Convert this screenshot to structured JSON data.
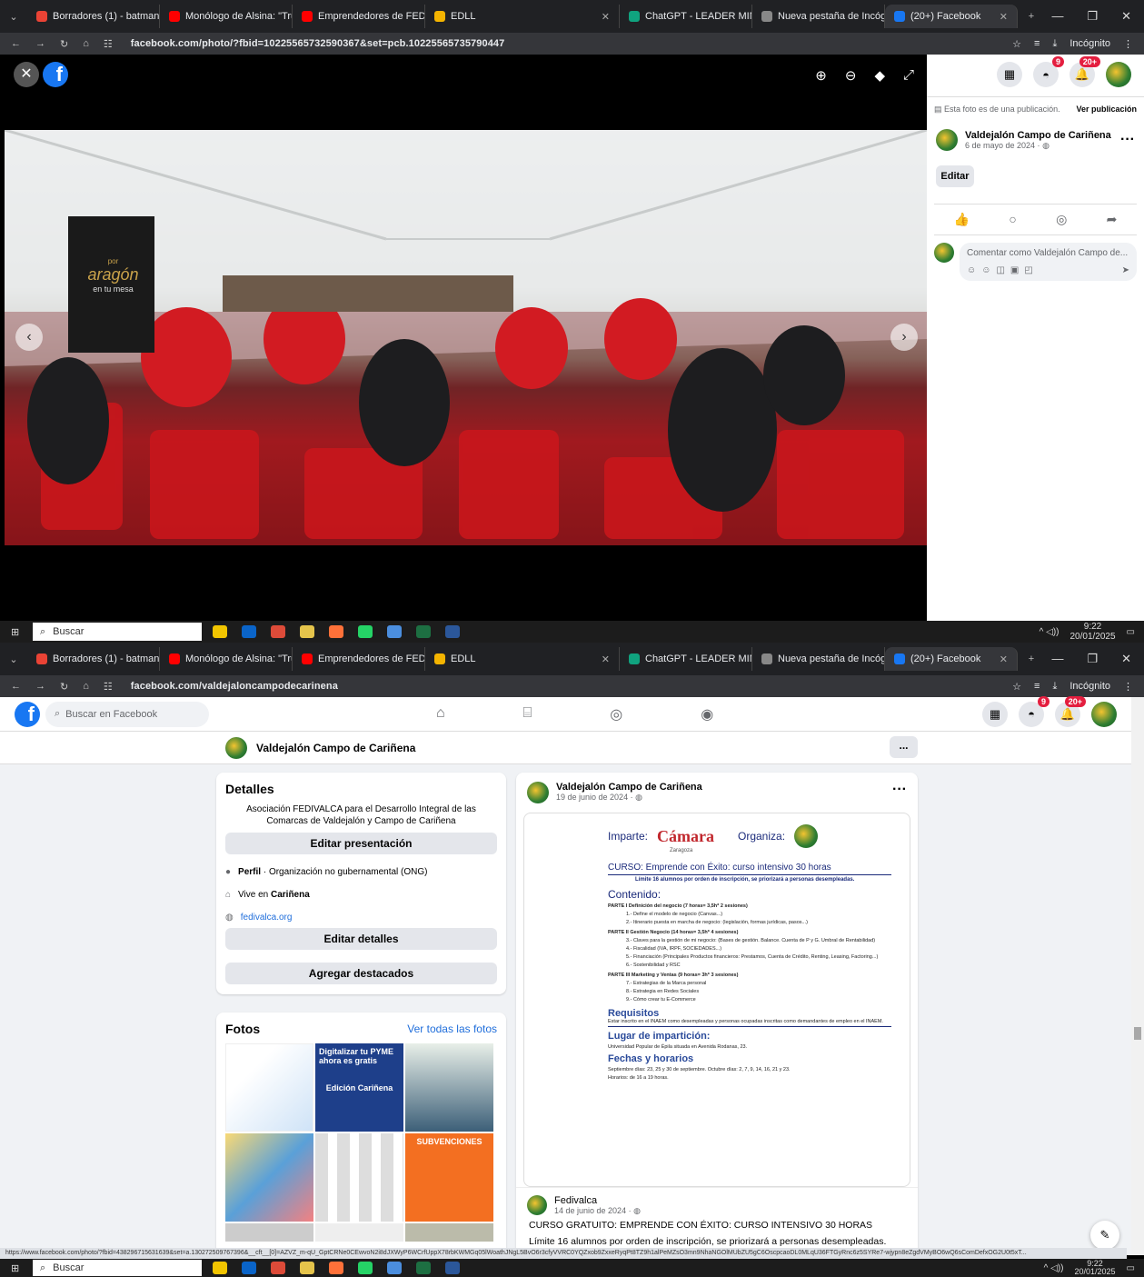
{
  "browser": {
    "tabs": [
      {
        "label": "Borradores (1) - batmanorteroll",
        "color": "#ea4335"
      },
      {
        "label": "Monólogo de Alsina: \"Trum",
        "color": "#ff0000"
      },
      {
        "label": "Emprendedores de FEDIVALCA",
        "color": "#ff0000"
      },
      {
        "label": "EDLL",
        "color": "#f4b400"
      },
      {
        "label": "ChatGPT - LEADER MIND",
        "color": "#10a37f"
      },
      {
        "label": "Nueva pestaña de Incógnito",
        "color": "#888888"
      },
      {
        "label": "(20+) Facebook",
        "color": "#1877f2"
      }
    ],
    "url_top": "facebook.com/photo/?fbid=10225565732590367&set=pcb.10225565735790447",
    "url_bottom": "facebook.com/valdejaloncampodecarinena",
    "incognito": "Incógnito"
  },
  "photo_viewer": {
    "banner_brand": "aragón",
    "banner_small": "por",
    "banner_sub": "en tu mesa",
    "notice": "Esta foto es de una publicación.",
    "see_post": "Ver publicación",
    "author": "Valdejalón Campo de Cariñena",
    "date": "6 de mayo de 2024 · ",
    "edit": "Editar",
    "comment_placeholder": "Comentar como Valdejalón Campo de..."
  },
  "notifications": {
    "messenger": "9",
    "bell": "20+"
  },
  "taskbar": {
    "search": "Buscar",
    "time": "9:22",
    "date": "20/01/2025"
  },
  "profile": {
    "search_placeholder": "Buscar en Facebook",
    "page_name": "Valdejalón Campo de Cariñena",
    "more": "...",
    "details_title": "Detalles",
    "description": "Asociación FEDIVALCA para el Desarrollo Integral de las Comarcas de Valdejalón y Campo de Cariñena",
    "edit_presentation": "Editar presentación",
    "profile_label": "Perfil",
    "profile_value": " · Organización no gubernamental (ONG)",
    "lives_prefix": "Vive en ",
    "lives_city": "Cariñena",
    "website": "fedivalca.org",
    "edit_details": "Editar detalles",
    "add_featured": "Agregar destacados",
    "photos_title": "Fotos",
    "see_all_photos": "Ver todas las fotos",
    "photo_texts": [
      "Digitalizar tu PYME ahora es gratis",
      "Edición Cariñena",
      "SUBVENCIONES"
    ]
  },
  "post": {
    "author": "Valdejalón Campo de Cariñena",
    "date": "19 de junio de 2024 · ",
    "flyer": {
      "imparte": "Imparte:",
      "camara": "Cámara",
      "camara_sub": "Zaragoza",
      "organiza": "Organiza:",
      "curso": "CURSO: Emprende con Éxito: curso intensivo 30 horas",
      "limite": "Límite 16 alumnos por orden de inscripción, se priorizará a personas desempleadas.",
      "contenido": "Contenido:",
      "lines": [
        "PARTE I Definición del negocio (7 horas= 3,5h* 2 sesiones)",
        "1.- Define el modelo de negocio (Canvas...)",
        "2.- Itinerario puesta en marcha de negocio: (legislación, formas jurídicas, pasos...)",
        "PARTE II Gestión Negocio (14 horas= 3,5h* 4 sesiones)",
        "3.- Claves para la gestión de mi negocio: (Bases de gestión. Balance. Cuenta de P y G. Umbral de Rentabilidad)",
        "4.- Fiscalidad (IVA, IRPF, SOCIEDADES...)",
        "5.- Financiación (Principales Productos financieros: Prestamos, Cuenta de Crédito, Renting, Leasing, Factoring...)",
        "6.- Sostenibilidad y RSC",
        "PARTE III Marketing y Ventas (9 horas= 3h* 3 sesiones)",
        "7.- Estrategias de la Marca personal",
        "8.- Estrategia en Redes Sociales",
        "9.- Cómo crear tu E-Commerce"
      ],
      "requisitos": "Requisitos",
      "requisitos_text": "Estar inscrito en el INAEM como desempleadas y personas ocupadas inscritas como demandantes de empleo en el INAEM.",
      "lugar": "Lugar de impartición:",
      "lugar_text": "Universidad Popular de Épila situada en Avenida Rodanas, 23.",
      "fechas": "Fechas y horarios",
      "fechas_text": "Septiembre días: 23, 25 y 30 de septiembre.  Octubre días: 2, 7, 9, 14, 16, 21 y 23.",
      "horario": "Horarios: de 16 a 19 horas."
    },
    "shared_author": "Fedivalca",
    "shared_date": "14 de junio de 2024 · ",
    "shared_title": "CURSO GRATUITO: EMPRENDE CON ÉXITO: CURSO INTENSIVO 30 HORAS",
    "shared_text": "Límite 16 alumnos por orden de inscripción, se priorizará a personas desempleadas."
  },
  "status_url": "https://www.facebook.com/photo/?fbid=438296715631639&set=a.130272509767396&__cft__[0]=AZVZ_m-qU_GptCRNe0CEwvoN2i8dJXWyP6WCrfUppX78rbKWMGq05lWoathJNgL5BvO6r3cfyVVRC0YQZxob9ZxxeRyqPt8TZ9h1alPeMZsO3mn9NhaNGOlMUbZU5gC6OscpcaoDL0MLqU36FTGyRnc6z5SYRe7-wjypn8eZgdVMyBO6wQ6sComDefxOG2U0t5xT..."
}
